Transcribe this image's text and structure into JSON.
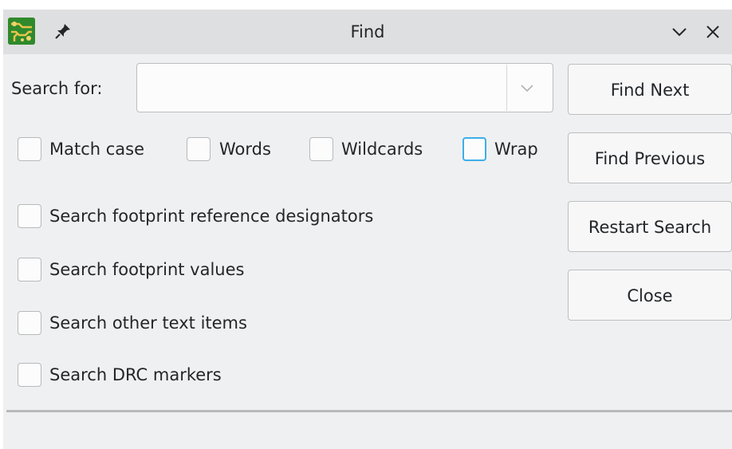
{
  "window": {
    "title": "Find"
  },
  "icons": {
    "app": "kicad-pcbnew-icon",
    "pin": "pin-icon",
    "minimize": "chevron-down-icon",
    "close": "close-icon",
    "dropdown": "chevron-down-icon"
  },
  "search": {
    "label": "Search for:",
    "value": "",
    "placeholder": ""
  },
  "options": {
    "match_case": {
      "label": "Match case",
      "checked": false
    },
    "words": {
      "label": "Words",
      "checked": false
    },
    "wildcards": {
      "label": "Wildcards",
      "checked": false
    },
    "wrap": {
      "label": "Wrap",
      "checked": false
    }
  },
  "scope": {
    "ref_designators": {
      "label": "Search footprint reference designators",
      "checked": false
    },
    "footprint_values": {
      "label": "Search footprint values",
      "checked": false
    },
    "other_text": {
      "label": "Search other text items",
      "checked": false
    },
    "drc_markers": {
      "label": "Search DRC markers",
      "checked": false
    }
  },
  "buttons": {
    "find_next": "Find Next",
    "find_previous": "Find Previous",
    "restart_search": "Restart Search",
    "close": "Close"
  },
  "colors": {
    "window_bg": "#eff0f1",
    "titlebar_bg": "#dedfe0",
    "focus_accent": "#3daee9",
    "text": "#232629"
  }
}
